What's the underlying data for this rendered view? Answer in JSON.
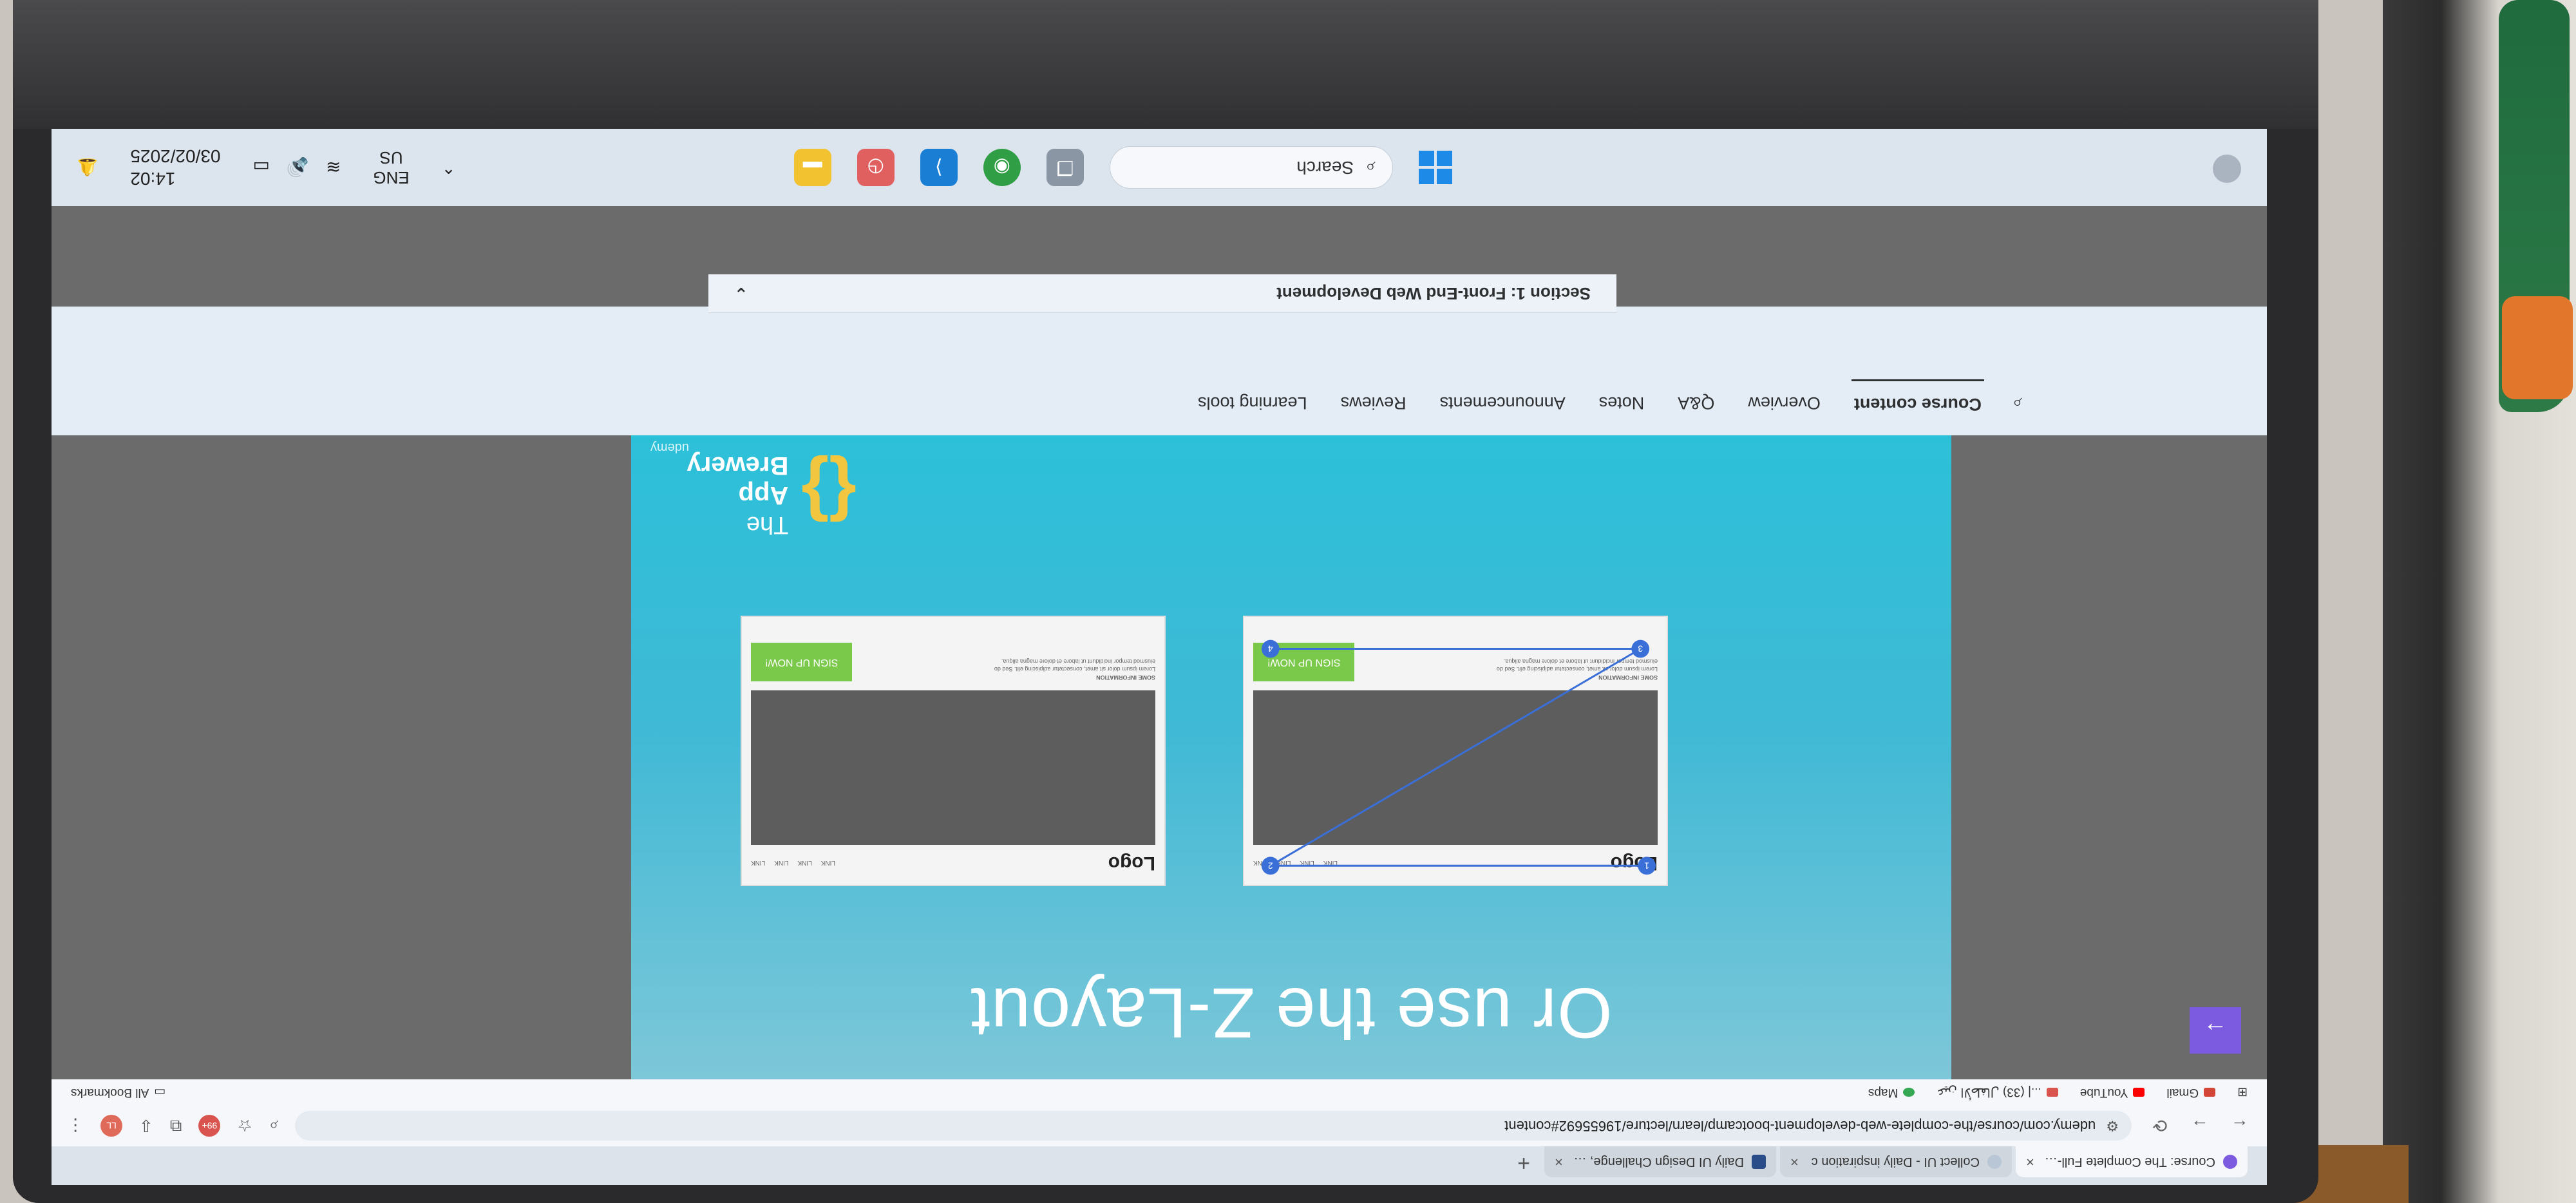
{
  "browser": {
    "tabs": [
      {
        "label": "Course: The Complete Full-Sta",
        "active": true
      },
      {
        "label": "Collect UI - Daily inspiration c",
        "active": false
      },
      {
        "label": "Daily UI Design Challenge, Insp",
        "active": false
      }
    ],
    "new_tab_glyph": "+",
    "url": "udemy.com/course/the-complete-web-development-bootcamp/learn/lecture/19655692#content",
    "extension_badge": "99+",
    "avatar_initials": "LL",
    "bookmarks": [
      {
        "label": "Gmail",
        "color": "#d44638"
      },
      {
        "label": "YouTube",
        "color": "#ff0000"
      },
      {
        "label": "...| عين الأطفال (33)",
        "color": "#d9534f"
      },
      {
        "label": "Maps",
        "color": "#34a853"
      }
    ],
    "all_bookmarks": "All Bookmarks"
  },
  "slide": {
    "title": "Or use the Z-Layout",
    "mockups": [
      {
        "logo": "Logo",
        "links": [
          "LINK",
          "LINK",
          "LINK",
          "LINK"
        ],
        "info_title": "SOME INFORMATION",
        "info_text": "Lorem ipsum dolor sit amet, consectetur adipiscing elit. Sed do eiusmod tempor incididunt ut labore et dolore magna aliqua.",
        "cta": "SIGN UP NOW!",
        "steps": [
          "1",
          "2",
          "3",
          "4"
        ]
      },
      {
        "logo": "Logo",
        "links": [
          "LINK",
          "LINK",
          "LINK",
          "LINK"
        ],
        "info_title": "SOME INFORMATION",
        "info_text": "Lorem ipsum dolor sit amet, consectetur adipiscing elit. Sed do eiusmod tempor incididunt ut labore et dolore magna aliqua.",
        "cta": "SIGN UP NOW!",
        "steps": []
      }
    ],
    "brand_prefix": "The",
    "brand_name": "App Brewery",
    "watermark": "udemy"
  },
  "course_tabs": [
    {
      "label": "Course content",
      "active": true
    },
    {
      "label": "Overview",
      "active": false
    },
    {
      "label": "Q&A",
      "active": false
    },
    {
      "label": "Notes",
      "active": false
    },
    {
      "label": "Announcements",
      "active": false
    },
    {
      "label": "Reviews",
      "active": false
    },
    {
      "label": "Learning tools",
      "active": false
    }
  ],
  "section": {
    "title": "Section 1: Front-End Web Development"
  },
  "taskbar": {
    "search_label": "Search",
    "lang_primary": "ENG",
    "lang_secondary": "US",
    "time": "14:02",
    "date": "03/02/2025"
  }
}
